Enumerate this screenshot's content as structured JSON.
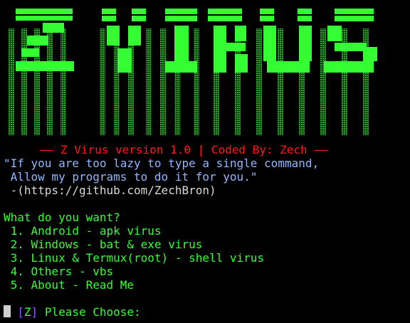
{
  "header": {
    "version_line": "—— Z Virus version 1.0 | Coded By: Zech ——",
    "quote_line1": "\"If you are too lazy to type a single command,",
    "quote_line2": " Allow my programs to do it for you.\"",
    "github_line": " -(https://github.com/ZechBron)"
  },
  "menu": {
    "prompt": "What do you want?",
    "items": [
      {
        "label": " 1. Android - apk virus"
      },
      {
        "label": " 2. Windows - bat & exe virus"
      },
      {
        "label": " 3. Linux & Termux(root) - shell virus"
      },
      {
        "label": " 4. Others - vbs"
      },
      {
        "label": " 5. About - Read Me"
      }
    ],
    "choose_tag": "Z",
    "choose_prompt": " Please Choose:"
  },
  "colors": {
    "background": "#000000",
    "banner_bright": "#33ff33",
    "banner_dim": "#1f8f1f",
    "red": "#ff1a1a",
    "blue": "#8fb7ff",
    "green": "#33ff33"
  },
  "banner_art": "Z VIRUS"
}
